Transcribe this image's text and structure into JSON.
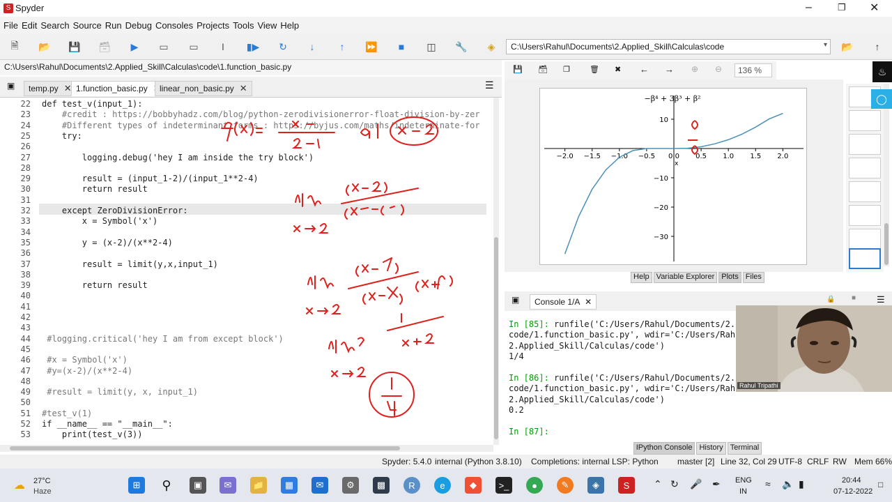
{
  "window": {
    "title": "Spyder"
  },
  "menu": [
    "File",
    "Edit",
    "Search",
    "Source",
    "Run",
    "Debug",
    "Consoles",
    "Projects",
    "Tools",
    "View",
    "Help"
  ],
  "cwd": "C:\\Users\\Rahul\\Documents\\2.Applied_Skill\\Calculas\\code",
  "editor": {
    "path": "C:\\Users\\Rahul\\Documents\\2.Applied_Skill\\Calculas\\code\\1.function_basic.py",
    "tabs": [
      {
        "label": "temp.py"
      },
      {
        "label": "1.function_basic.py"
      },
      {
        "label": "linear_non_basic.py"
      }
    ],
    "lines": [
      {
        "n": "22",
        "t": "def test_v(input_1):"
      },
      {
        "n": "23",
        "t": "    #credit : https://bobbyhadz.com/blog/python-zerodivisionerror-float-division-by-zer"
      },
      {
        "n": "24",
        "t": "    #Different types of indeterminant forms : https://byjus.com/maths/indeterminate-for"
      },
      {
        "n": "25",
        "t": "    try:"
      },
      {
        "n": "26",
        "t": ""
      },
      {
        "n": "27",
        "t": "        logging.debug('hey I am inside the try block')"
      },
      {
        "n": "28",
        "t": ""
      },
      {
        "n": "29",
        "t": "        result = (input_1-2)/(input_1**2-4)"
      },
      {
        "n": "30",
        "t": "        return result"
      },
      {
        "n": "31",
        "t": ""
      },
      {
        "n": "32",
        "t": "    except ZeroDivisionError:"
      },
      {
        "n": "33",
        "t": "        x = Symbol('x')"
      },
      {
        "n": "34",
        "t": ""
      },
      {
        "n": "35",
        "t": "        y = (x-2)/(x**2-4)"
      },
      {
        "n": "36",
        "t": ""
      },
      {
        "n": "37",
        "t": "        result = limit(y,x,input_1)"
      },
      {
        "n": "38",
        "t": ""
      },
      {
        "n": "39",
        "t": "        return result"
      },
      {
        "n": "40",
        "t": ""
      },
      {
        "n": "41",
        "t": ""
      },
      {
        "n": "42",
        "t": ""
      },
      {
        "n": "43",
        "t": ""
      },
      {
        "n": "44",
        "t": " #logging.critical('hey I am from except block')"
      },
      {
        "n": "45",
        "t": ""
      },
      {
        "n": "46",
        "t": " #x = Symbol('x')"
      },
      {
        "n": "47",
        "t": " #y=(x-2)/(x**2-4)"
      },
      {
        "n": "48",
        "t": ""
      },
      {
        "n": "49",
        "t": " #result = limit(y, x, input_1)"
      },
      {
        "n": "50",
        "t": ""
      },
      {
        "n": "51",
        "t": "#test_v(1)"
      },
      {
        "n": "52",
        "t": "if __name__ == \"__main__\":"
      },
      {
        "n": "53",
        "t": "    print(test_v(3))"
      }
    ]
  },
  "plot": {
    "zoom": "136 %",
    "title": "−β⁴ + 3β³ + β²",
    "x_ticks": [
      "−2.0",
      "−1.5",
      "−1.0",
      "−0.5",
      "0.0",
      "0.5",
      "1.0",
      "1.5",
      "2.0"
    ],
    "y_ticks": [
      "10",
      "0",
      "−10",
      "−20",
      "−30"
    ],
    "x_label": "x"
  },
  "chart_data": {
    "type": "line",
    "title": "−β⁴ + 3β³ + β²",
    "xlabel": "x",
    "ylabel": "",
    "xlim": [
      -2.2,
      2.2
    ],
    "ylim": [
      -37,
      15
    ],
    "x": [
      -2.0,
      -1.75,
      -1.5,
      -1.25,
      -1.0,
      -0.75,
      -0.5,
      -0.25,
      0.0,
      0.25,
      0.5,
      0.75,
      1.0,
      1.25,
      1.5,
      1.75,
      2.0
    ],
    "series": [
      {
        "values": [
          -36.0,
          -23.3,
          -13.9,
          -7.3,
          -3.0,
          -0.7,
          0.0,
          0.0,
          0.0,
          0.1,
          0.6,
          1.6,
          3.0,
          4.9,
          7.3,
          10.1,
          12.0
        ]
      }
    ],
    "color": "#4a90b8"
  },
  "pane_tabs": [
    "Help",
    "Variable Explorer",
    "Plots",
    "Files"
  ],
  "console": {
    "tab": "Console 1/A",
    "lines": [
      {
        "a": "In [85]: ",
        "b": "runfile('C:/Users/Rahul/Documents/2."
      },
      {
        "a": "",
        "b": "code/1.function_basic.py', wdir='C:/Users/Rah"
      },
      {
        "a": "",
        "b": "2.Applied_Skill/Calculas/code')"
      },
      {
        "a": "",
        "b": "1/4"
      },
      {
        "a": "",
        "b": ""
      },
      {
        "a": "In [86]: ",
        "b": "runfile('C:/Users/Rahul/Documents/2."
      },
      {
        "a": "",
        "b": "code/1.function_basic.py', wdir='C:/Users/Rah"
      },
      {
        "a": "",
        "b": "2.Applied_Skill/Calculas/code')"
      },
      {
        "a": "",
        "b": "0.2"
      },
      {
        "a": "",
        "b": ""
      },
      {
        "a": "In [87]: ",
        "b": ""
      }
    ],
    "webcam_name": "Rahul Tripathi"
  },
  "console_tabs": [
    "IPython Console",
    "History",
    "Terminal"
  ],
  "status": {
    "spyder": "Spyder: 5.4.0",
    "interp": "internal (Python 3.8.10)",
    "completions": "Completions: internal",
    "lsp": "LSP: Python",
    "git": "master [2]",
    "pos": "Line 32, Col 29",
    "enc": "UTF-8",
    "eol": "CRLF",
    "rw": "RW",
    "mem": "Mem 66%"
  },
  "taskbar": {
    "weather_temp": "27°C",
    "weather_desc": "Haze",
    "lang": "ENG",
    "region": "IN",
    "time": "20:44",
    "date": "07-12-2022"
  },
  "colors": {
    "accent": "#2a7bd6",
    "annotation": "#e0201c"
  }
}
